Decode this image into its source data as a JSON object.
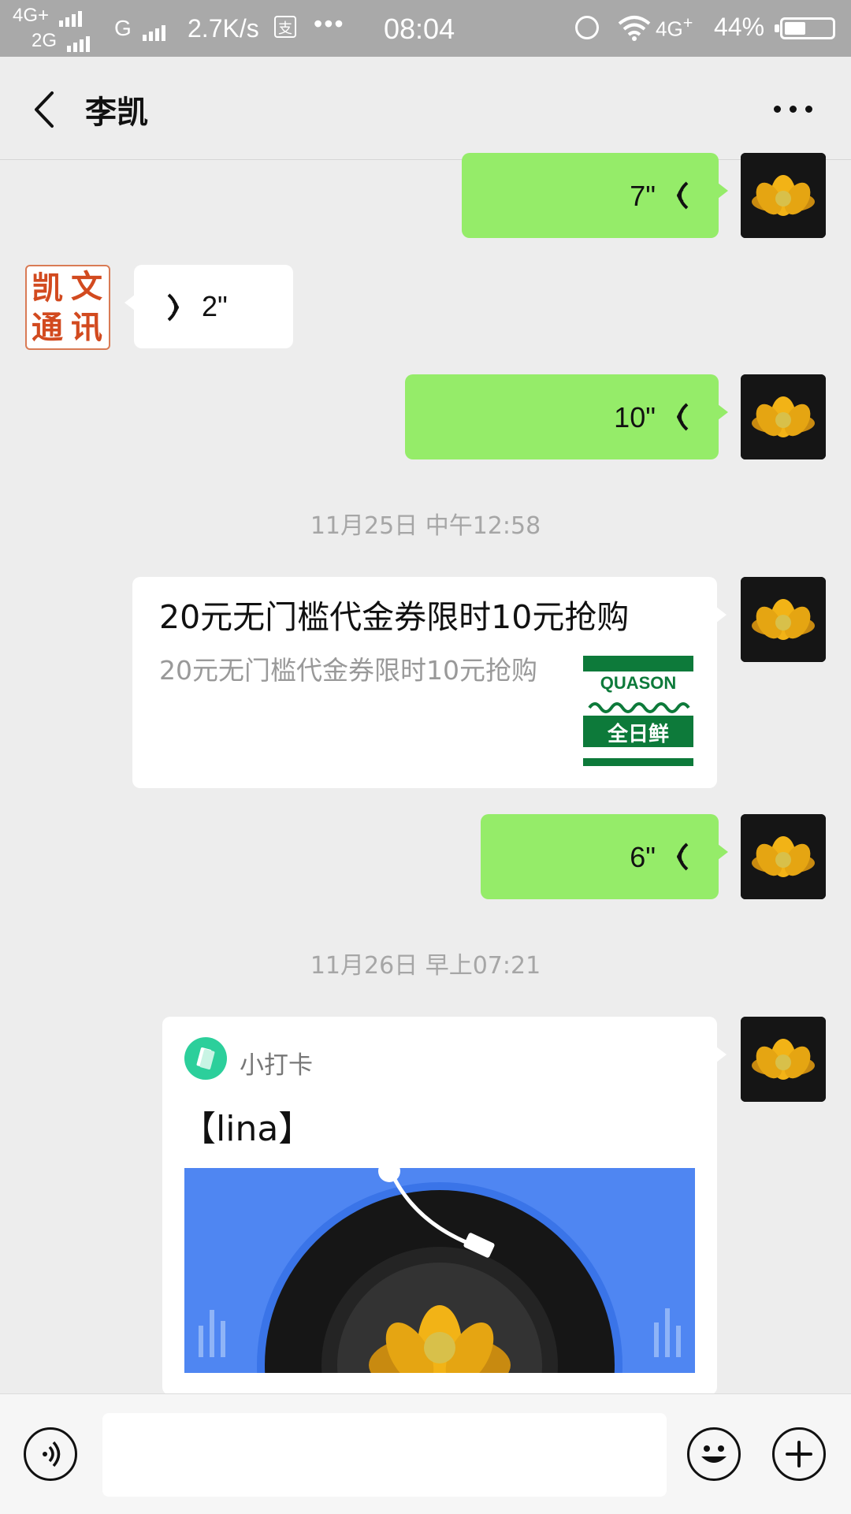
{
  "status_bar": {
    "network_top": "4G+",
    "network_bottom": "2G",
    "network_g": "G",
    "speed": "2.7K/s",
    "pay_icon": "支",
    "overflow": "•••",
    "time": "08:04",
    "network_right": "4G",
    "battery": "44%",
    "battery_level": 0.44
  },
  "header": {
    "title": "李凯"
  },
  "messages": {
    "m1": {
      "duration": "7\""
    },
    "m2": {
      "duration": "2\"",
      "avatar_text": [
        "凯",
        "文",
        "通",
        "讯"
      ]
    },
    "m3": {
      "duration": "10\""
    },
    "ts1": "11月25日 中午12:58",
    "m4": {
      "title": "20元无门槛代金券限时10元抢购",
      "desc": "20元无门槛代金券限时10元抢购",
      "thumb_brand": "QUASON",
      "thumb_text": "全日鲜"
    },
    "m5": {
      "duration": "6\""
    },
    "ts2": "11月26日 早上07:21",
    "m6": {
      "app_name": "小打卡",
      "title": "【lina】"
    }
  },
  "colors": {
    "sent_bubble": "#95ec69",
    "received_bubble": "#ffffff",
    "background": "#ededed",
    "miniapp_icon": "#2ccf9b",
    "miniapp_banner": "#4f86f2",
    "thumb_green": "#0d7a3a"
  },
  "icons": {
    "back": "chevron-left-icon",
    "more": "more-dots-icon",
    "voice_toggle": "voice-icon",
    "emoji": "emoji-icon",
    "plus": "plus-icon"
  }
}
